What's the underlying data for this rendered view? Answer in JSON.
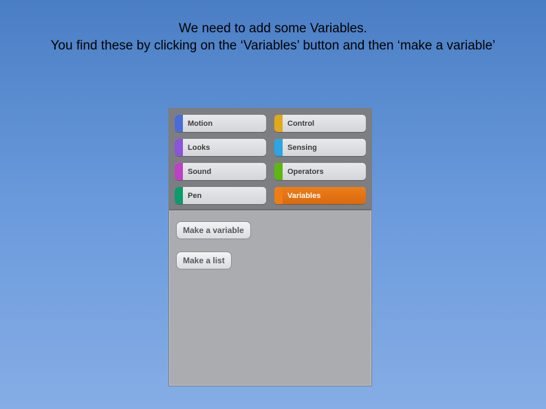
{
  "instruction": {
    "line1": "We need to add some Variables.",
    "line2": "You find these by clicking on the ‘Variables’ button and then ‘make a variable’"
  },
  "categories": [
    {
      "label": "Motion",
      "tab_color": "#4a6cd4",
      "selected": false
    },
    {
      "label": "Control",
      "tab_color": "#e1a91a",
      "selected": false
    },
    {
      "label": "Looks",
      "tab_color": "#8a55d7",
      "selected": false
    },
    {
      "label": "Sensing",
      "tab_color": "#2ca5e2",
      "selected": false
    },
    {
      "label": "Sound",
      "tab_color": "#bb42c3",
      "selected": false
    },
    {
      "label": "Operators",
      "tab_color": "#5cb712",
      "selected": false
    },
    {
      "label": "Pen",
      "tab_color": "#0e9a6c",
      "selected": false
    },
    {
      "label": "Variables",
      "tab_color": "#ee7d16",
      "selected": true,
      "selected_bg": "#ee7d16"
    }
  ],
  "buttons": {
    "make_variable": "Make a variable",
    "make_list": "Make a list"
  }
}
